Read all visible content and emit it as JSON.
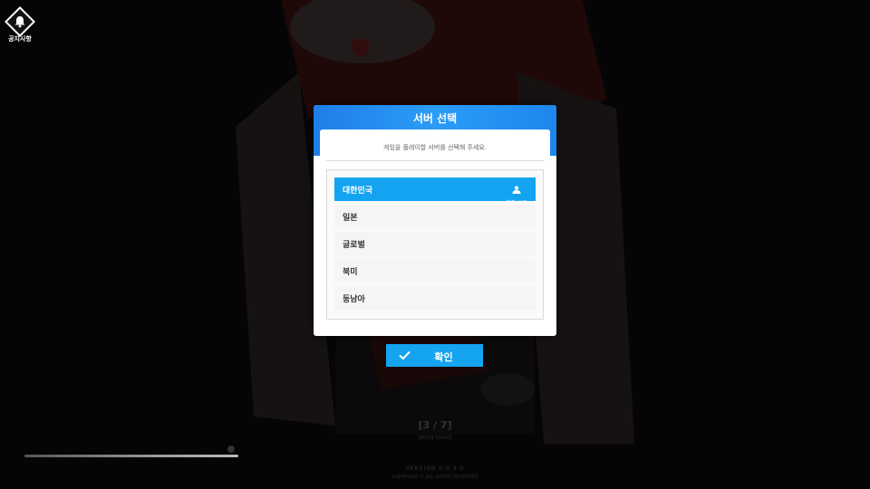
{
  "notice": {
    "label": "공지사항",
    "icon": "bell-icon"
  },
  "dialog": {
    "title": "서버 선택",
    "subtitle": "게임을 플레이할 서버를 선택해 주세요.",
    "servers": [
      {
        "name": "대한민국",
        "selected": true,
        "account_label": "계정 보유"
      },
      {
        "name": "일본",
        "selected": false
      },
      {
        "name": "글로벌",
        "selected": false
      },
      {
        "name": "북미",
        "selected": false
      },
      {
        "name": "동남아",
        "selected": false
      }
    ]
  },
  "confirm": {
    "label": "확인",
    "icon": "check-icon"
  },
  "loading": {
    "progress": "[3 / 7]",
    "status": "World Select",
    "version": "VERSION 0.0.3.0",
    "copyright": "COPYRIGHT © ALL RIGHTS RESERVED"
  },
  "colors": {
    "accent": "#14a3f0",
    "header": "#1f7ee8",
    "background": "#000000"
  }
}
